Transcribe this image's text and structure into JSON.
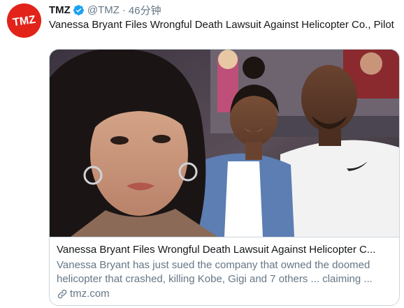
{
  "tweet": {
    "avatar_logo_text": "TMZ",
    "display_name": "TMZ",
    "handle": "@TMZ",
    "separator": "·",
    "timestamp": "46分钟",
    "text": "Vanessa Bryant Files Wrongful Death Lawsuit Against Helicopter Co., Pilot"
  },
  "card": {
    "title": "Vanessa Bryant Files Wrongful Death Lawsuit Against Helicopter C...",
    "description": "Vanessa Bryant has just sued the company that owned the doomed helicopter that crashed, killing Kobe, Gigi and 7 others ... claiming ...",
    "domain": "tmz.com",
    "link_icon": "link-icon"
  },
  "icons": {
    "verified": "verified-badge-icon",
    "link": "link-icon"
  },
  "colors": {
    "brand_red": "#e2231a",
    "verified_blue": "#1da1f2",
    "text_primary": "#14171a",
    "text_secondary": "#657786",
    "border": "#ccd6dd"
  }
}
